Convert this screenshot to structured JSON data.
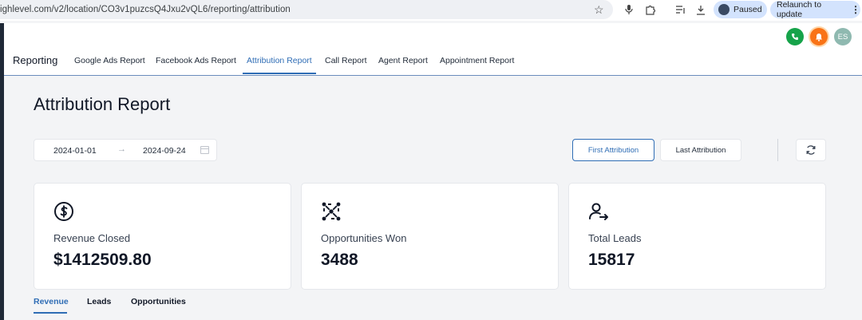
{
  "browser": {
    "url": "ighlevel.com/v2/location/CO3v1puzcsQ4Jxu2vQL6/reporting/attribution",
    "paused_label": "Paused",
    "relaunch_label": "Relaunch to update",
    "icons": [
      "star-icon",
      "microphone-icon",
      "extensions-icon",
      "media-queue-icon",
      "download-icon",
      "profile-avatar-icon",
      "more-vert-icon"
    ]
  },
  "header": {
    "title": "Reporting",
    "tabs": [
      {
        "label": "Google Ads Report",
        "active": false
      },
      {
        "label": "Facebook Ads Report",
        "active": false
      },
      {
        "label": "Attribution Report",
        "active": true
      },
      {
        "label": "Call Report",
        "active": false
      },
      {
        "label": "Agent Report",
        "active": false
      },
      {
        "label": "Appointment Report",
        "active": false
      }
    ],
    "avatar_initials": "ES",
    "accent_color": "#2f6db5"
  },
  "main": {
    "title": "Attribution Report",
    "date_range": {
      "start": "2024-01-01",
      "end": "2024-09-24"
    },
    "attribution_buttons": {
      "first": "First Attribution",
      "last": "Last Attribution",
      "selected": "first"
    },
    "cards": [
      {
        "icon": "dollar-circle-icon",
        "label": "Revenue Closed",
        "value": "$1412509.80"
      },
      {
        "icon": "network-icon",
        "label": "Opportunities Won",
        "value": "3488"
      },
      {
        "icon": "user-arrow-icon",
        "label": "Total Leads",
        "value": "15817"
      }
    ],
    "subtabs": [
      {
        "label": "Revenue",
        "active": true
      },
      {
        "label": "Leads",
        "active": false
      },
      {
        "label": "Opportunities",
        "active": false
      }
    ]
  }
}
